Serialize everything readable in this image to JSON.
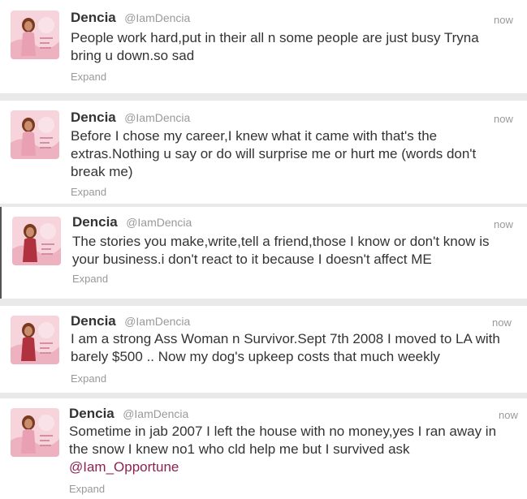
{
  "tweets": [
    {
      "name": "Dencia",
      "handle": "@IamDencia",
      "time": "now",
      "text": "People work hard,put in their all n some people are just busy Tryna bring u down.so sad",
      "expand": "Expand"
    },
    {
      "name": "Dencia",
      "handle": "@IamDencia",
      "time": "now",
      "text": "Before I chose my career,I knew what it came with that's the extras.Nothing u say or do will surprise me or hurt me (words don't break me)",
      "expand": "Expand"
    },
    {
      "name": "Dencia",
      "handle": "@IamDencia",
      "time": "now",
      "text": "The stories you make,write,tell a friend,those I know or don't know is your business.i don't react to it because I doesn't affect ME",
      "expand": "Expand"
    },
    {
      "name": "Dencia",
      "handle": "@IamDencia",
      "time": "now",
      "text": "I am a strong Ass Woman n Survivor.Sept 7th 2008 I moved to LA with barely $500 .. Now my dog's upkeep costs that much weekly",
      "expand": "Expand"
    },
    {
      "name": "Dencia",
      "handle": "@IamDencia",
      "time": "now",
      "text_before_mention": "Sometime in jab 2007 I left the house with no money,yes I ran away in the snow I knew no1 who cld help me but I survived ask",
      "mention": "@Iam_Opportune",
      "expand": "Expand"
    }
  ],
  "colors": {
    "text": "#333333",
    "muted": "#999999",
    "mention": "#8b2252",
    "avatar_bg": "#f4c6cf"
  },
  "icons": {
    "avatar": "profile-photo-icon"
  }
}
